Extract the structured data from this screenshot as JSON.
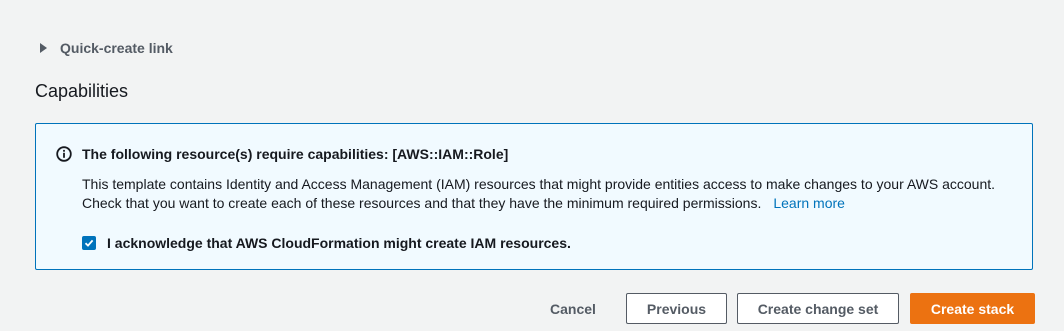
{
  "quick_create": {
    "label": "Quick-create link",
    "expanded": false
  },
  "capabilities": {
    "title": "Capabilities",
    "alert": {
      "icon": "info-icon",
      "title": "The following resource(s) require capabilities: [AWS::IAM::Role]",
      "body_line1": "This template contains Identity and Access Management (IAM) resources that might provide entities access to make changes to your AWS account.",
      "body_line2": "Check that you want to create each of these resources and that they have the minimum required permissions.",
      "learn_more": "Learn more"
    },
    "acknowledge": {
      "label": "I acknowledge that AWS CloudFormation might create IAM resources.",
      "checked": true
    }
  },
  "footer": {
    "cancel_label": "Cancel",
    "previous_label": "Previous",
    "change_set_label": "Create change set",
    "create_label": "Create stack"
  },
  "colors": {
    "primary": "#ec7211",
    "link": "#0073bb",
    "alert_background": "#f1faff",
    "page_background": "#f2f3f3"
  }
}
